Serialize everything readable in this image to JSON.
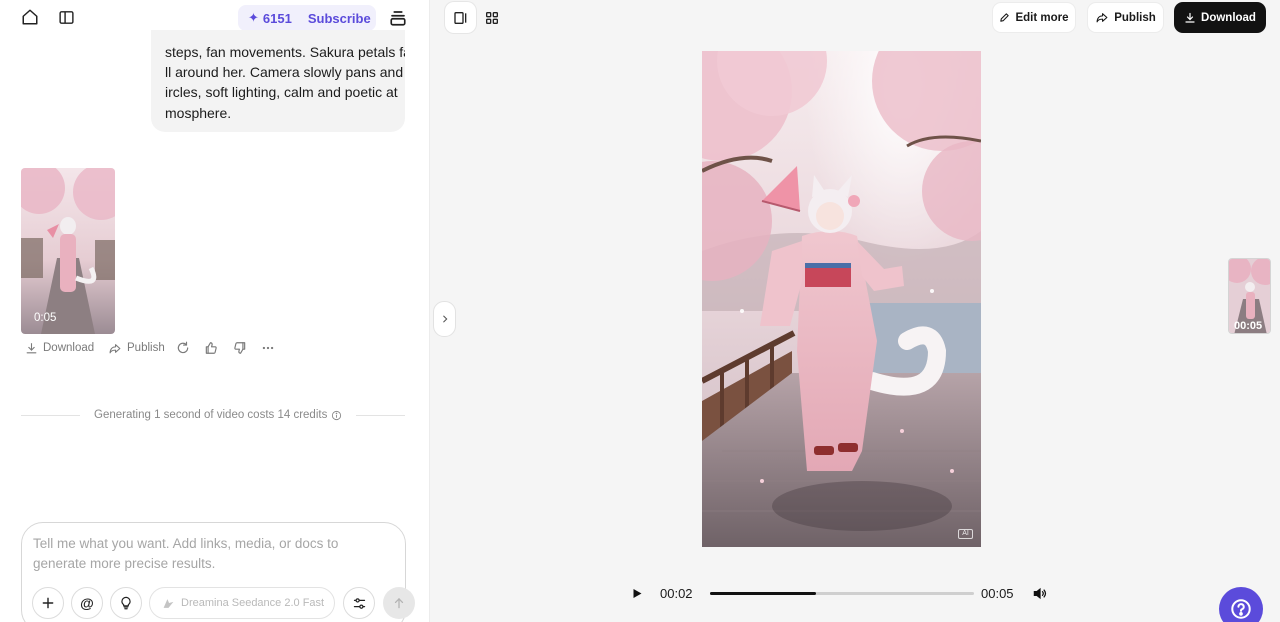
{
  "left_panel": {
    "credits": {
      "amount": "6151",
      "subscribe_label": "Subscribe",
      "icon": "sparkle-icon"
    },
    "message_lines": [
      "steps, fan movements. Sakura petals fa",
      "ll around her. Camera slowly pans and c",
      "ircles, soft lighting, calm and poetic at",
      "mosphere."
    ],
    "video_card": {
      "duration": "0:05",
      "actions": {
        "download": "Download",
        "publish": "Publish"
      }
    },
    "cost_notice": "Generating 1 second of video costs 14 credits",
    "composer": {
      "placeholder": "Tell me what you want. Add links, media, or docs to generate more precise results.",
      "mention_symbol": "@",
      "model_label": "Dreamina Seedance 2.0 Fast"
    }
  },
  "right_panel": {
    "toolbar": {
      "edit_label": "Edit more",
      "publish_label": "Publish",
      "download_label": "Download"
    },
    "watermark": "AI",
    "side_thumb_time": "00:05",
    "player": {
      "current_time": "00:02",
      "total_time": "00:05",
      "progress": 0.4
    }
  },
  "colors": {
    "accent": "#5b4bdb",
    "download_bg": "#121212",
    "panel_bg": "#f5f5f5"
  }
}
